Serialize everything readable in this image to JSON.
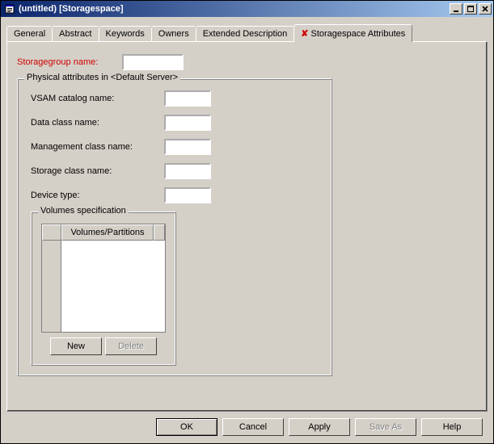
{
  "window": {
    "title": "(untitled) [Storagespace]"
  },
  "tabs": [
    {
      "label": "General"
    },
    {
      "label": "Abstract"
    },
    {
      "label": "Keywords"
    },
    {
      "label": "Owners"
    },
    {
      "label": "Extended Description"
    },
    {
      "label": "Storagespace Attributes",
      "active": true,
      "error": true
    }
  ],
  "form": {
    "storagegroup_label": "Storagegroup name:",
    "storagegroup_value": "",
    "phys_group_title": "Physical attributes in <Default Server>",
    "vsam_label": "VSAM catalog name:",
    "vsam_value": "",
    "dataclass_label": "Data class name:",
    "dataclass_value": "",
    "mgmtclass_label": "Management class name:",
    "mgmtclass_value": "",
    "storageclass_label": "Storage class name:",
    "storageclass_value": "",
    "devicetype_label": "Device type:",
    "devicetype_value": "",
    "volumes_group_title": "Volumes specification",
    "volumes_column": "Volumes/Partitions",
    "new_btn": "New",
    "delete_btn": "Delete"
  },
  "buttons": {
    "ok": "OK",
    "cancel": "Cancel",
    "apply": "Apply",
    "saveas": "Save As",
    "help": "Help"
  }
}
